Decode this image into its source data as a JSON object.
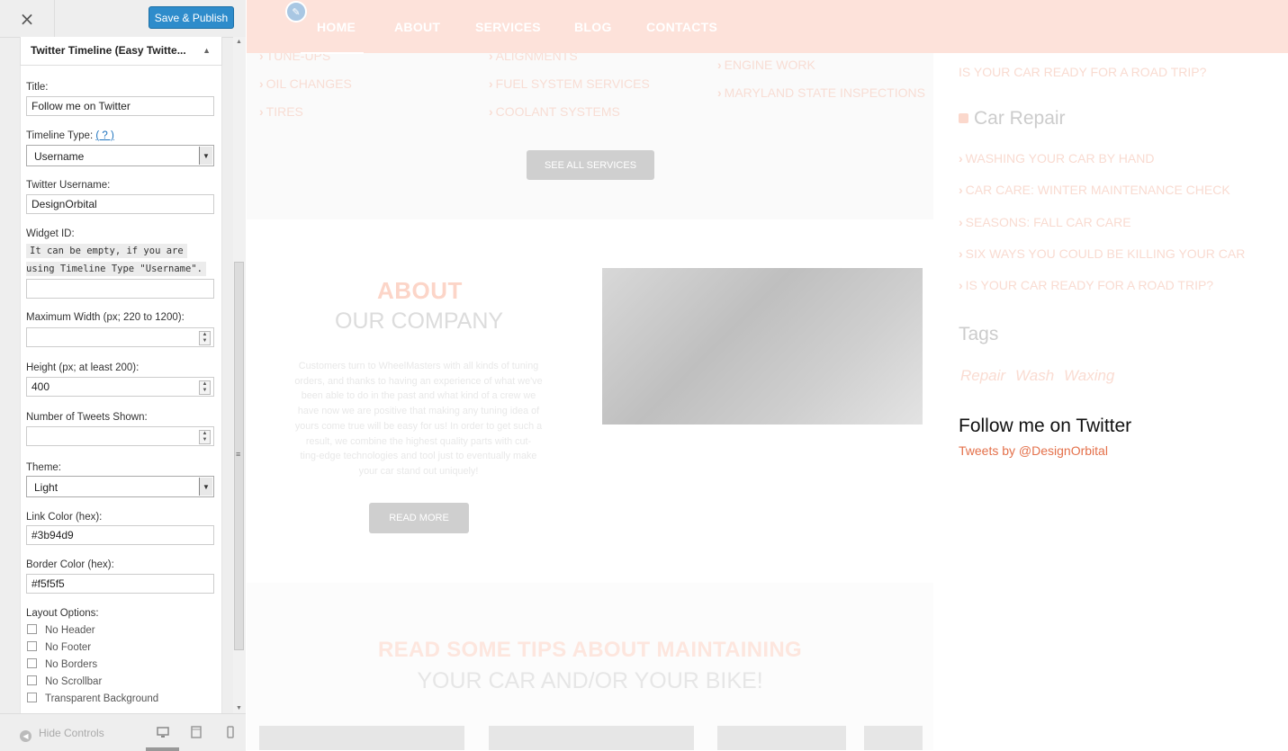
{
  "header": {
    "close_symbol": "×",
    "save_label": "Save & Publish"
  },
  "widget": {
    "title": "Twitter Timeline (Easy Twitte...",
    "title_field": {
      "label": "Title:",
      "value": "Follow me on Twitter"
    },
    "timeline_type": {
      "label": "Timeline Type:",
      "help": "( ? )",
      "value": "Username"
    },
    "username": {
      "label": "Twitter Username:",
      "value": "DesignOrbital"
    },
    "widget_id": {
      "label": "Widget ID:",
      "note_line1": "It can be empty, if you are",
      "note_line2": "using Timeline Type \"Username\".",
      "value": ""
    },
    "max_width": {
      "label": "Maximum Width (px; 220 to 1200):",
      "value": ""
    },
    "height": {
      "label": "Height (px; at least 200):",
      "value": "400"
    },
    "tweets_shown": {
      "label": "Number of Tweets Shown:",
      "value": ""
    },
    "theme": {
      "label": "Theme:",
      "value": "Light"
    },
    "link_color": {
      "label": "Link Color (hex):",
      "value": "#3b94d9"
    },
    "border_color": {
      "label": "Border Color (hex):",
      "value": "#f5f5f5"
    },
    "layout": {
      "label": "Layout Options:",
      "options": [
        "No Header",
        "No Footer",
        "No Borders",
        "No Scrollbar",
        "Transparent Background"
      ]
    }
  },
  "footer": {
    "hide_controls": "Hide Controls"
  },
  "preview": {
    "nav": [
      "HOME",
      "ABOUT",
      "SERVICES",
      "BLOG",
      "CONTACTS"
    ],
    "services": {
      "col1": [
        "TUNE-UPS",
        "OIL CHANGES",
        "TIRES"
      ],
      "col2": [
        "ALIGNMENTS",
        "FUEL SYSTEM SERVICES",
        "COOLANT SYSTEMS"
      ],
      "col3": [
        "ENGINE WORK",
        "MARYLAND STATE INSPECTIONS"
      ],
      "button": "SEE ALL SERVICES"
    },
    "about": {
      "title": "ABOUT",
      "subtitle": "OUR COMPANY",
      "text_lines": [
        "Customers turn to WheelMasters with all kinds of tuning",
        "orders, and thanks to having an experience of what we've",
        "been able to do in the past and what kind of a crew we",
        "have now we are positive that making any tuning idea of",
        "yours come true will be easy for us! In order to get such a",
        "result, we combine the highest quality parts with cut-",
        "ting-edge technologies and tool just to eventually make",
        "your car stand out uniquely!"
      ],
      "button": "READ MORE"
    },
    "tips": {
      "title": "READ SOME TIPS ABOUT MAINTAINING",
      "subtitle": "YOUR CAR AND/OR YOUR BIKE!"
    },
    "sidebar": {
      "top_link": "IS YOUR CAR READY FOR A ROAD TRIP?",
      "car_repair_title": "Car Repair",
      "car_repair_links": [
        "WASHING YOUR CAR BY HAND",
        "CAR CARE: WINTER MAINTENANCE CHECK",
        "SEASONS: FALL CAR CARE",
        "SIX WAYS YOU COULD BE KILLING YOUR CAR",
        "IS YOUR CAR READY FOR A ROAD TRIP?"
      ],
      "tags_title": "Tags",
      "tags": [
        "Repair",
        "Wash",
        "Waxing"
      ],
      "twitter_title": "Follow me on Twitter",
      "twitter_link": "Tweets by @DesignOrbital"
    }
  }
}
